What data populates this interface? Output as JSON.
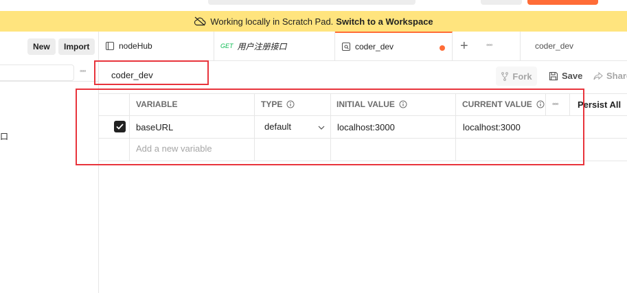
{
  "banner": {
    "text": "Working locally in Scratch Pad.",
    "link": "Switch to a Workspace"
  },
  "sidebar": {
    "new_label": "New",
    "import_label": "Import",
    "partial_glyph": "口"
  },
  "tabs": [
    {
      "label": "nodeHub"
    },
    {
      "method": "GET",
      "label": "用户注册接口"
    },
    {
      "label": "coder_dev"
    }
  ],
  "environment_selector": "coder_dev",
  "environment": {
    "name": "coder_dev",
    "fork_label": "Fork",
    "save_label": "Save",
    "share_label": "Share"
  },
  "table": {
    "headers": {
      "variable": "VARIABLE",
      "type": "TYPE",
      "initial": "INITIAL VALUE",
      "current": "CURRENT VALUE",
      "persist": "Persist All"
    },
    "rows": [
      {
        "checked": true,
        "variable": "baseURL",
        "type": "default",
        "initial": "localhost:3000",
        "current": "localhost:3000"
      }
    ],
    "add_placeholder": "Add a new variable"
  },
  "colors": {
    "banner": "#ffe47e",
    "accent": "#ff6c37",
    "annotation": "#e8333b"
  }
}
